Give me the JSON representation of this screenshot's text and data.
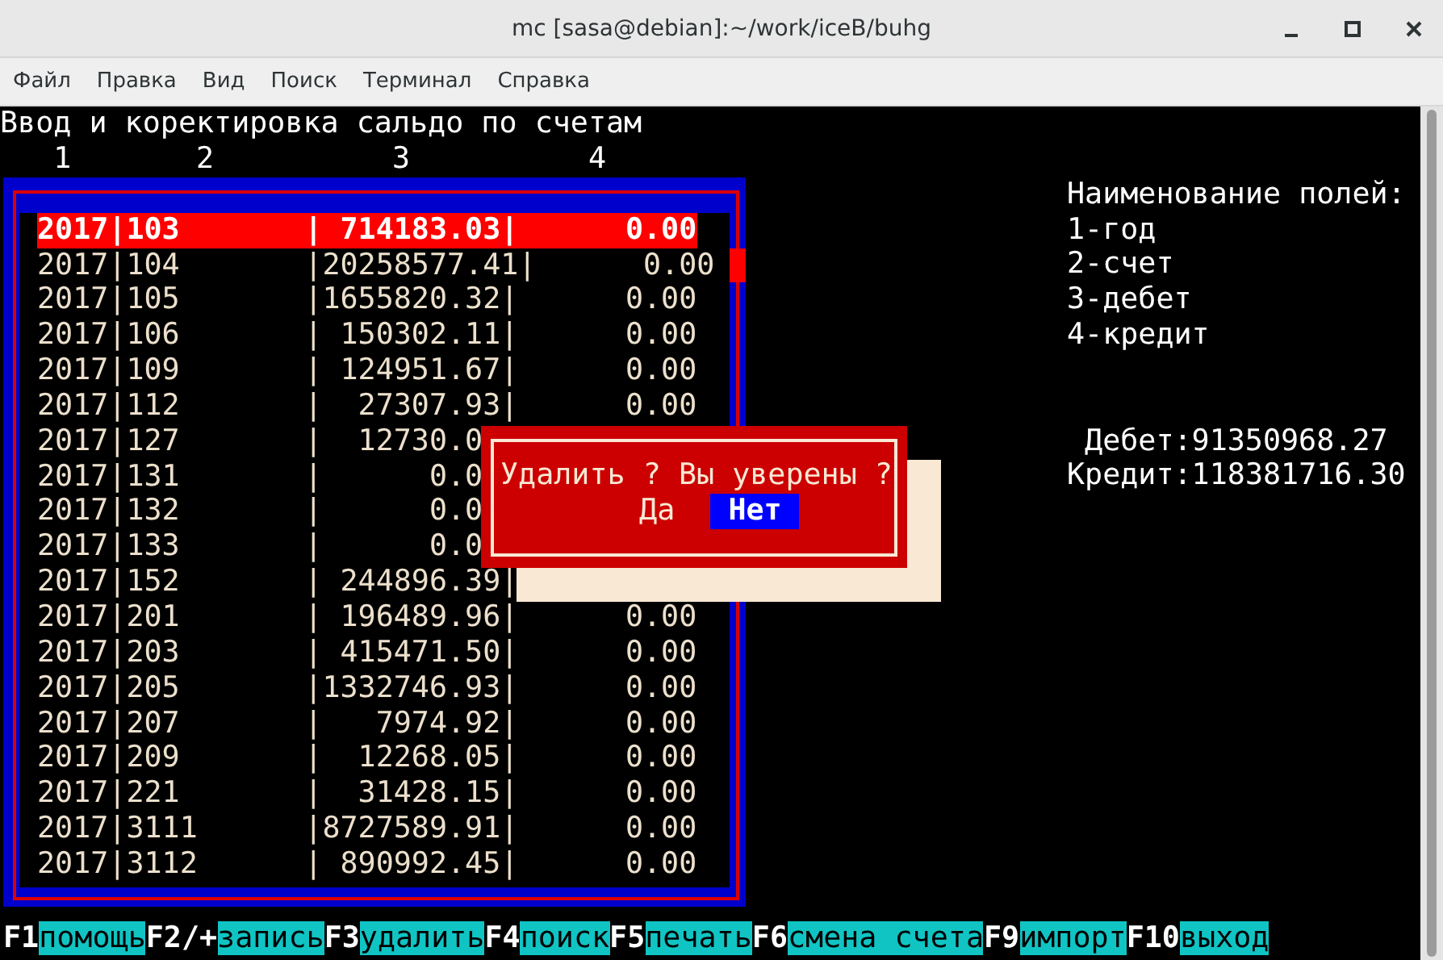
{
  "window": {
    "title": "mc [sasa@debian]:~/work/iceB/buhg"
  },
  "menu": [
    "Файл",
    "Правка",
    "Вид",
    "Поиск",
    "Терминал",
    "Справка"
  ],
  "terminal": {
    "heading": "Ввод и коректировка сальдо по счетам",
    "column_numbers": [
      "1",
      "2",
      "3",
      "4"
    ],
    "rows": [
      {
        "text": "2017|103       | 714183.03|      0.00",
        "selected": true
      },
      {
        "text": "2017|104       |20258577.41|      0.00",
        "selected": false
      },
      {
        "text": "2017|105       |1655820.32|      0.00",
        "selected": false
      },
      {
        "text": "2017|106       | 150302.11|      0.00",
        "selected": false
      },
      {
        "text": "2017|109       | 124951.67|      0.00",
        "selected": false
      },
      {
        "text": "2017|112       |  27307.93|      0.00",
        "selected": false
      },
      {
        "text": "2017|127       |  12730.0",
        "selected": false
      },
      {
        "text": "2017|131       |      0.0",
        "selected": false
      },
      {
        "text": "2017|132       |      0.0",
        "selected": false
      },
      {
        "text": "2017|133       |      0.0",
        "selected": false
      },
      {
        "text": "2017|152       | 244896.39|",
        "selected": false
      },
      {
        "text": "2017|201       | 196489.96|      0.00",
        "selected": false
      },
      {
        "text": "2017|203       | 415471.50|      0.00",
        "selected": false
      },
      {
        "text": "2017|205       |1332746.93|      0.00",
        "selected": false
      },
      {
        "text": "2017|207       |   7974.92|      0.00",
        "selected": false
      },
      {
        "text": "2017|209       |  12268.05|      0.00",
        "selected": false
      },
      {
        "text": "2017|221       |  31428.15|      0.00",
        "selected": false
      },
      {
        "text": "2017|3111      |8727589.91|      0.00",
        "selected": false
      },
      {
        "text": "2017|3112      | 890992.45|      0.00",
        "selected": false
      }
    ],
    "legend": {
      "title": "Наименование полей:",
      "items": [
        "1-год",
        "2-счет",
        "3-дебет",
        "4-кредит"
      ]
    },
    "totals": [
      "Дебет:91350968.27",
      "Кредит:118381716.30"
    ],
    "dialog": {
      "message": "Удалить ? Вы уверены ?",
      "buttons": [
        {
          "label": "Да",
          "selected": false
        },
        {
          "label": "Нет",
          "selected": true
        }
      ]
    },
    "function_keys": [
      {
        "key": "F1",
        "label": "помощь"
      },
      {
        "key": "F2/+",
        "label": "запись"
      },
      {
        "key": "F3",
        "label": "удалить"
      },
      {
        "key": "F4",
        "label": "поиск"
      },
      {
        "key": "F5",
        "label": "печать"
      },
      {
        "key": "F6",
        "label": "смена счета"
      },
      {
        "key": "F9",
        "label": "импорт"
      },
      {
        "key": "F10",
        "label": "выход"
      }
    ]
  }
}
